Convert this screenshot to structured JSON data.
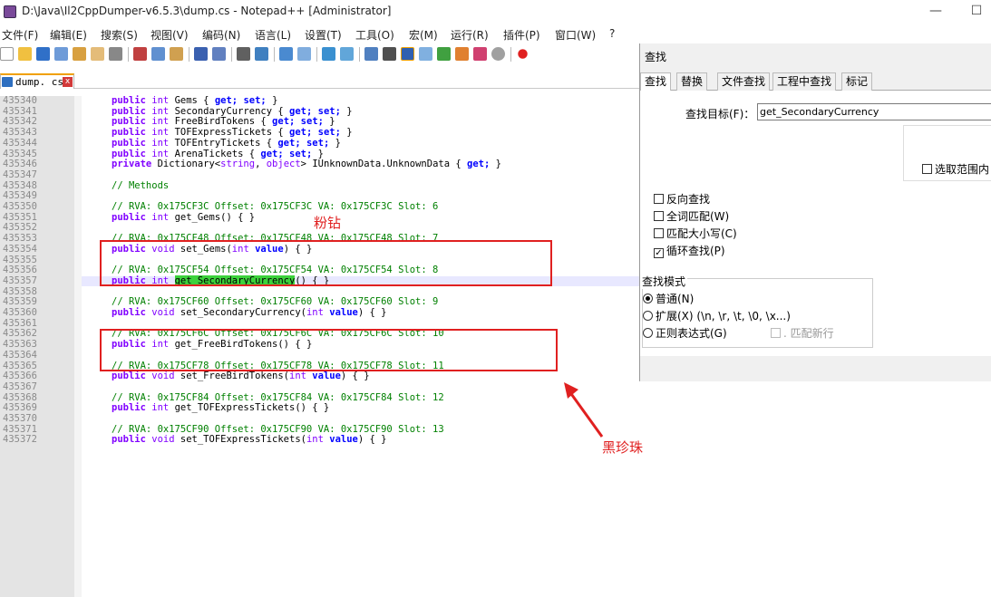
{
  "window": {
    "title": "D:\\Java\\Il2CppDumper-v6.5.3\\dump.cs - Notepad++ [Administrator]",
    "minimize": "—",
    "maximize": "☐"
  },
  "menu": [
    "文件(F)",
    "编辑(E)",
    "搜索(S)",
    "视图(V)",
    "编码(N)",
    "语言(L)",
    "设置(T)",
    "工具(O)",
    "宏(M)",
    "运行(R)",
    "插件(P)",
    "窗口(W)",
    "?"
  ],
  "tab": {
    "label": "dump. cs",
    "close": "x"
  },
  "lines": [
    {
      "n": "435340"
    },
    {
      "n": "435341"
    },
    {
      "n": "435342"
    },
    {
      "n": "435343"
    },
    {
      "n": "435344"
    },
    {
      "n": "435345"
    },
    {
      "n": "435346"
    },
    {
      "n": "435347"
    },
    {
      "n": "435348"
    },
    {
      "n": "435349"
    },
    {
      "n": "435350"
    },
    {
      "n": "435351"
    },
    {
      "n": "435352"
    },
    {
      "n": "435353"
    },
    {
      "n": "435354"
    },
    {
      "n": "435355"
    },
    {
      "n": "435356"
    },
    {
      "n": "435357"
    },
    {
      "n": "435358"
    },
    {
      "n": "435359"
    },
    {
      "n": "435360"
    },
    {
      "n": "435361"
    },
    {
      "n": "435362"
    },
    {
      "n": "435363"
    },
    {
      "n": "435364"
    },
    {
      "n": "435365"
    },
    {
      "n": "435366"
    },
    {
      "n": "435367"
    },
    {
      "n": "435368"
    },
    {
      "n": "435369"
    },
    {
      "n": "435370"
    },
    {
      "n": "435371"
    },
    {
      "n": "435372"
    }
  ],
  "code": {
    "c0_name": "Gems",
    "c1_name": "SecondaryCurrency",
    "c2_name": "FreeBirdTokens",
    "c3_name": "TOFExpressTickets",
    "c4_name": "TOFEntryTickets",
    "c5_name": "ArenaTickets",
    "c6": "Dictionary<",
    "c6b": "string",
    "c6c": ", ",
    "c6d": "object",
    "c6e": "> IUnknownData.UnknownData { ",
    "methods_comment": "// Methods",
    "rva6": "// RVA: 0x175CF3C Offset: 0x175CF3C VA: 0x175CF3C Slot: 6",
    "m6": "get_Gems() { }",
    "rva7": "// RVA: 0x175CF48 Offset: 0x175CF48 VA: 0x175CF48 Slot: 7",
    "m7": "set_Gems(",
    "rva8": "// RVA: 0x175CF54 Offset: 0x175CF54 VA: 0x175CF54 Slot: 8",
    "m8": "get_SecondaryCurrency",
    "m8b": "() { }",
    "rva9": "// RVA: 0x175CF60 Offset: 0x175CF60 VA: 0x175CF60 Slot: 9",
    "m9": "set_SecondaryCurrency(",
    "rva10": "// RVA: 0x175CF6C Offset: 0x175CF6C VA: 0x175CF6C Slot: 10",
    "m10": "get_FreeBirdTokens() { }",
    "rva11": "// RVA: 0x175CF78 Offset: 0x175CF78 VA: 0x175CF78 Slot: 11",
    "m11": "set_FreeBirdTokens(",
    "rva12": "// RVA: 0x175CF84 Offset: 0x175CF84 VA: 0x175CF84 Slot: 12",
    "m12": "get_TOFExpressTickets() { }",
    "rva13": "// RVA: 0x175CF90 Offset: 0x175CF90 VA: 0x175CF90 Slot: 13",
    "m13": "set_TOFExpressTickets(",
    "kw_public": "public",
    "kw_private": "private",
    "kw_int": "int",
    "kw_void": "void",
    "kw_get": "get;",
    "kw_set": "set;",
    "kw_value": "value",
    "close_paren": ") { }",
    "open_brace": " { ",
    "close_brace": " }",
    "brace_only": "}"
  },
  "annotations": {
    "pink_diamond": "粉钻",
    "black_pearl": "黑珍珠"
  },
  "find": {
    "title": "查找",
    "tabs": [
      "查找",
      "替换",
      "文件查找",
      "工程中查找",
      "标记"
    ],
    "target_label": "查找目标(F)：",
    "target_value": "get_SecondaryCurrency",
    "in_selection": "选取范围内",
    "reverse": "反向查找",
    "whole_word": "全词匹配(W)",
    "match_case": "匹配大小写(C)",
    "wrap": "循环查找(P)",
    "mode_title": "查找模式",
    "mode_normal": "普通(N)",
    "mode_extended": "扩展(X) (\\n, \\r, \\t, \\0, \\x...)",
    "mode_regex": "正则表达式(G)",
    "dot_newline": ". 匹配新行"
  },
  "colors": {
    "keyword": "#8000ff",
    "comment": "#008000",
    "match_highlight": "#3cd23c",
    "annotation_red": "#e02020"
  }
}
